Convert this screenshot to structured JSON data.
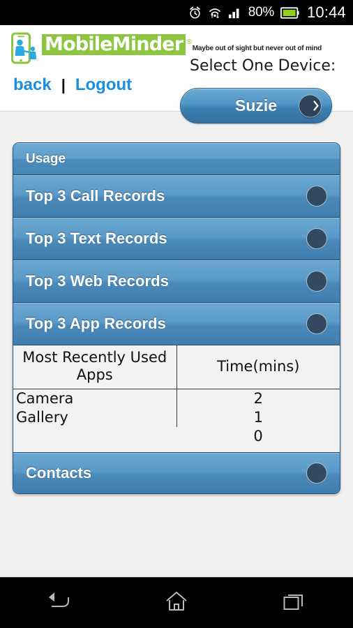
{
  "statusbar": {
    "icons": [
      "alarm-icon",
      "wifi-icon",
      "signal-icon",
      "battery-icon"
    ],
    "battery_percent": "80%",
    "time": "10:44"
  },
  "header": {
    "logo": {
      "icon": "mobileminder-logo-icon",
      "word_part1": "Mobile",
      "word_part2": "Minder",
      "registered_mark": "®",
      "tagline": "Maybe out of sight but never out of mind",
      "green": "#8cc63e",
      "blue": "#29abe2"
    },
    "back_label": "back",
    "separator": "|",
    "logout_label": "Logout",
    "select_device_label": "Select One Device:",
    "device_button": {
      "label": "Suzie",
      "knob_icon": "chevron-right-icon"
    },
    "link_color": "#1a8fe0"
  },
  "main": {
    "section_title": "Usage",
    "rows": [
      {
        "label": "Top 3 Call Records",
        "dot_icon": "circle-indicator-icon"
      },
      {
        "label": "Top 3 Text Records",
        "dot_icon": "circle-indicator-icon"
      },
      {
        "label": "Top 3 Web Records",
        "dot_icon": "circle-indicator-icon"
      },
      {
        "label": "Top 3 App Records",
        "dot_icon": "circle-indicator-icon"
      }
    ],
    "app_table": {
      "headers": [
        "Most Recently Used Apps",
        "Time(mins)"
      ],
      "rows": [
        {
          "app": "Camera",
          "time": "2"
        },
        {
          "app": "Gallery",
          "time": "1"
        },
        {
          "app": "",
          "time": "0"
        }
      ]
    },
    "contacts_row": {
      "label": "Contacts",
      "dot_icon": "circle-indicator-icon"
    },
    "accent_blue": "#5b9bc9",
    "border_blue": "#25527a"
  },
  "navbar": {
    "back_icon": "back-arrow-icon",
    "home_icon": "home-icon",
    "recents_icon": "recent-apps-icon"
  }
}
